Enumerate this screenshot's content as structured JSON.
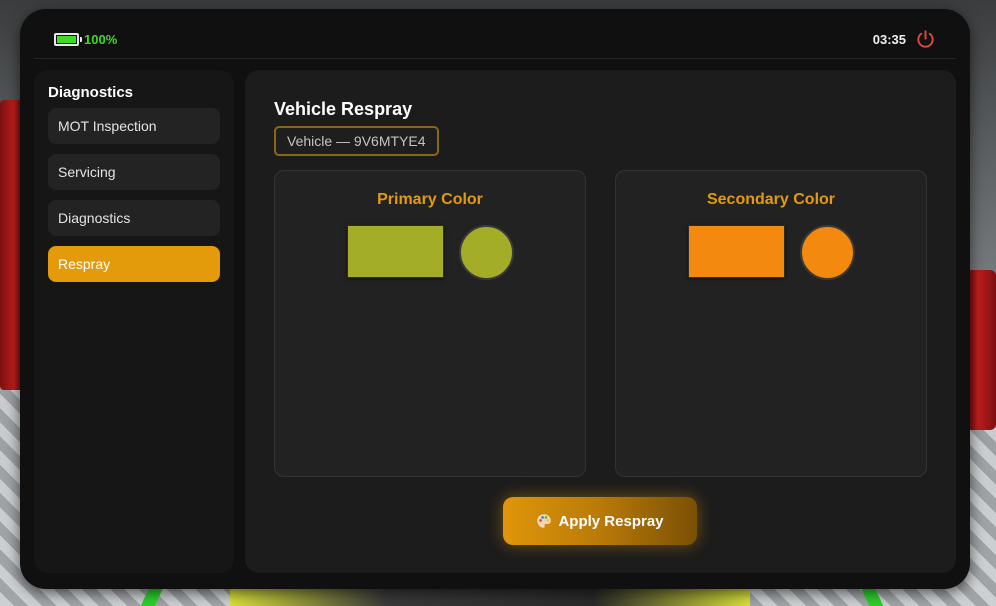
{
  "statusbar": {
    "battery_text": "100%",
    "time": "03:35"
  },
  "sidebar": {
    "title": "Diagnostics",
    "items": [
      {
        "label": "MOT Inspection"
      },
      {
        "label": "Servicing"
      },
      {
        "label": "Diagnostics"
      },
      {
        "label": "Respray"
      }
    ],
    "active_index": 3
  },
  "main": {
    "title": "Vehicle Respray",
    "vehicle_badge": "Vehicle — 9V6MTYE4",
    "primary": {
      "title": "Primary Color",
      "color": "#a4ad28"
    },
    "secondary": {
      "title": "Secondary Color",
      "color": "#f38a0f"
    },
    "apply_label": "Apply Respray"
  },
  "colors": {
    "accent": "#e39a0b",
    "battery": "#3ddc23",
    "power": "#e5463a"
  },
  "icons": [
    "battery-icon",
    "power-icon",
    "palette-icon"
  ]
}
